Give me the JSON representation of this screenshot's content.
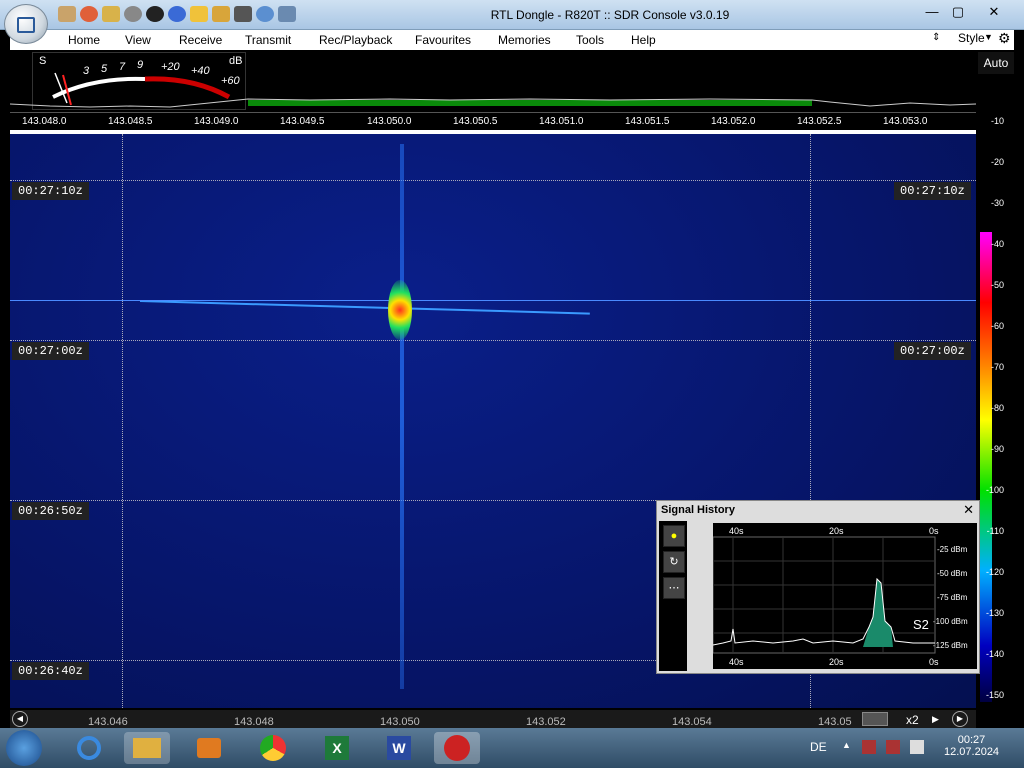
{
  "window": {
    "title": "RTL Dongle - R820T :: SDR Console v3.0.19",
    "minimize": "—",
    "maximize": "▢",
    "close": "✕"
  },
  "menu": {
    "items": [
      "Home",
      "View",
      "Receive",
      "Transmit",
      "Rec/Playback",
      "Favourites",
      "Memories",
      "Tools",
      "Help"
    ],
    "style_label": "Style"
  },
  "smeter": {
    "s_label": "S",
    "db_label": "dB",
    "s_scale": [
      "3",
      "5",
      "7",
      "9"
    ],
    "db_scale": [
      "+20",
      "+40",
      "+60"
    ]
  },
  "freq_scale": [
    "143.048.0",
    "143.048.5",
    "143.049.0",
    "143.049.5",
    "143.050.0",
    "143.050.5",
    "143.051.0",
    "143.051.5",
    "143.052.0",
    "143.052.5",
    "143.053.0"
  ],
  "colorbar": {
    "auto_label": "Auto",
    "db_ticks": [
      "-10",
      "-20",
      "-30",
      "-40",
      "-50",
      "-60",
      "-70",
      "-80",
      "-90",
      "-100",
      "-110",
      "-120",
      "-130",
      "-140",
      "-150"
    ]
  },
  "waterfall": {
    "timestamps": [
      "00:27:10z",
      "00:27:00z",
      "00:26:50z",
      "00:26:40z"
    ]
  },
  "signal_history": {
    "title": "Signal History",
    "close": "✕",
    "top_axis": [
      "40s",
      "20s",
      "0s"
    ],
    "bottom_axis": [
      "40s",
      "20s",
      "0s"
    ],
    "y_axis": [
      "-25 dBm",
      "-50 dBm",
      "-75 dBm",
      "-100 dBm",
      "-125 dBm"
    ],
    "s_reading": "S2",
    "button_icons": [
      "record-icon",
      "refresh-icon",
      "more-icon"
    ]
  },
  "bottom_scale": {
    "labels": [
      "143.046",
      "143.048",
      "143.050",
      "143.052",
      "143.054",
      "143.05"
    ],
    "zoom": "x2"
  },
  "taskbar": {
    "language": "DE",
    "time": "00:27",
    "date": "12.07.2024",
    "apps": [
      "ie-icon",
      "explorer-icon",
      "media-icon",
      "chrome-icon",
      "excel-icon",
      "word-icon",
      "sdr-console-icon"
    ]
  }
}
